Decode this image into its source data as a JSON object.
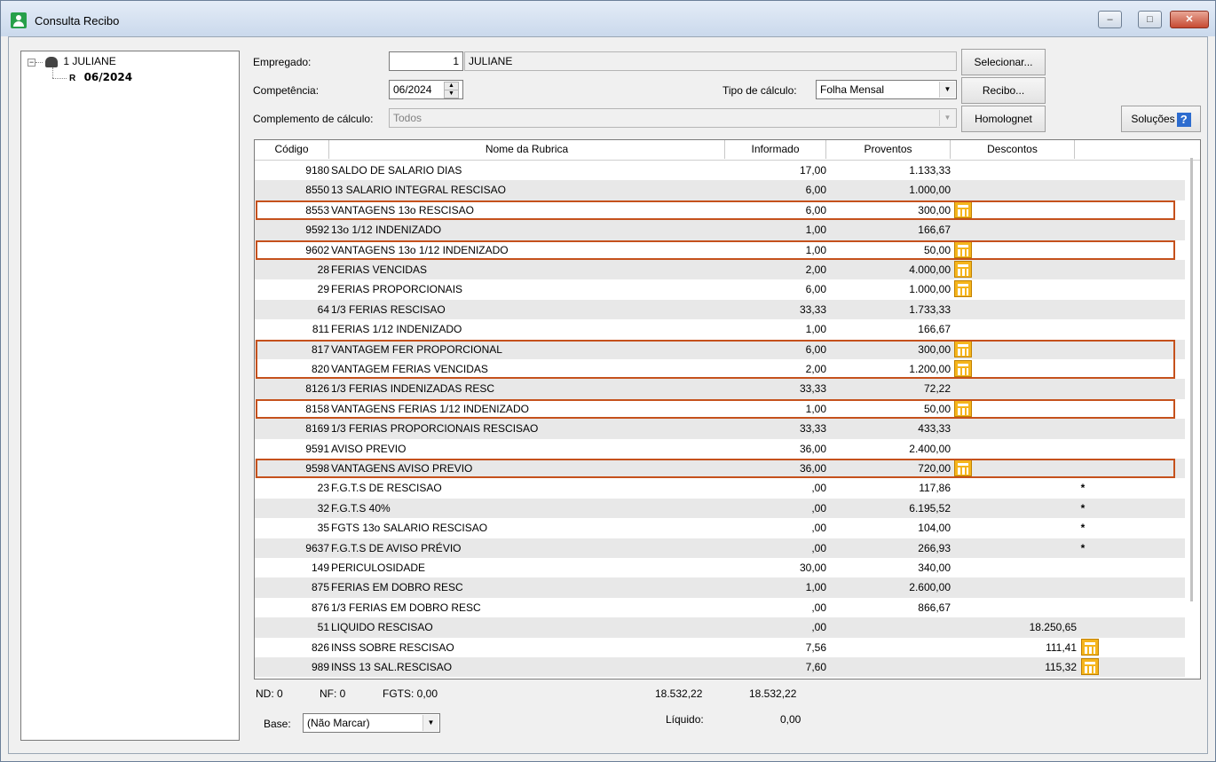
{
  "window": {
    "title": "Consulta Recibo",
    "minimize": "–",
    "maximize": "□",
    "close": "✕"
  },
  "tree": {
    "root_label": "1 JULIANE",
    "child_label": "06/2024",
    "child_marker": "R",
    "expander": "−"
  },
  "form": {
    "empregado_label": "Empregado:",
    "empregado_code": "1",
    "empregado_name": "JULIANE",
    "competencia_label": "Competência:",
    "competencia_value": "06/2024",
    "tipo_calculo_label": "Tipo de cálculo:",
    "tipo_calculo_value": "Folha Mensal",
    "complemento_label": "Complemento de cálculo:",
    "complemento_value": "Todos"
  },
  "buttons": {
    "selecionar": "Selecionar...",
    "recibo": "Recibo...",
    "homolognet": "Homolognet",
    "solucoes": "Soluções",
    "help": "?"
  },
  "grid": {
    "headers": {
      "codigo": "Código",
      "nome": "Nome da Rubrica",
      "informado": "Informado",
      "proventos": "Proventos",
      "descontos": "Descontos"
    },
    "rows": [
      {
        "code": "9180",
        "name": "SALDO DE SALARIO DIAS",
        "informado": "17,00",
        "proventos": "1.133,33",
        "descontos": "",
        "star": "",
        "calc": "",
        "highlight": false
      },
      {
        "code": "8550",
        "name": "13 SALARIO INTEGRAL RESCISAO",
        "informado": "6,00",
        "proventos": "1.000,00",
        "descontos": "",
        "star": "",
        "calc": "",
        "highlight": false
      },
      {
        "code": "8553",
        "name": "VANTAGENS 13o RESCISAO",
        "informado": "6,00",
        "proventos": "300,00",
        "descontos": "",
        "star": "",
        "calc": "prov",
        "highlight": true
      },
      {
        "code": "9592",
        "name": "13o 1/12 INDENIZADO",
        "informado": "1,00",
        "proventos": "166,67",
        "descontos": "",
        "star": "",
        "calc": "",
        "highlight": false
      },
      {
        "code": "9602",
        "name": "VANTAGENS 13o 1/12 INDENIZADO",
        "informado": "1,00",
        "proventos": "50,00",
        "descontos": "",
        "star": "",
        "calc": "prov",
        "highlight": true
      },
      {
        "code": "28",
        "name": "FERIAS VENCIDAS",
        "informado": "2,00",
        "proventos": "4.000,00",
        "descontos": "",
        "star": "",
        "calc": "prov",
        "highlight": false
      },
      {
        "code": "29",
        "name": "FERIAS PROPORCIONAIS",
        "informado": "6,00",
        "proventos": "1.000,00",
        "descontos": "",
        "star": "",
        "calc": "prov",
        "highlight": false
      },
      {
        "code": "64",
        "name": "1/3 FERIAS RESCISAO",
        "informado": "33,33",
        "proventos": "1.733,33",
        "descontos": "",
        "star": "",
        "calc": "",
        "highlight": false
      },
      {
        "code": "811",
        "name": "FERIAS 1/12 INDENIZADO",
        "informado": "1,00",
        "proventos": "166,67",
        "descontos": "",
        "star": "",
        "calc": "",
        "highlight": false
      },
      {
        "code": "817",
        "name": "VANTAGEM FER PROPORCIONAL",
        "informado": "6,00",
        "proventos": "300,00",
        "descontos": "",
        "star": "",
        "calc": "prov",
        "highlight": "top"
      },
      {
        "code": "820",
        "name": "VANTAGEM FERIAS VENCIDAS",
        "informado": "2,00",
        "proventos": "1.200,00",
        "descontos": "",
        "star": "",
        "calc": "prov",
        "highlight": "bottom"
      },
      {
        "code": "8126",
        "name": "1/3 FERIAS INDENIZADAS RESC",
        "informado": "33,33",
        "proventos": "72,22",
        "descontos": "",
        "star": "",
        "calc": "",
        "highlight": false
      },
      {
        "code": "8158",
        "name": "VANTAGENS FERIAS 1/12 INDENIZADO",
        "informado": "1,00",
        "proventos": "50,00",
        "descontos": "",
        "star": "",
        "calc": "prov",
        "highlight": true
      },
      {
        "code": "8169",
        "name": "1/3 FERIAS PROPORCIONAIS RESCISAO",
        "informado": "33,33",
        "proventos": "433,33",
        "descontos": "",
        "star": "",
        "calc": "",
        "highlight": false
      },
      {
        "code": "9591",
        "name": "AVISO PREVIO",
        "informado": "36,00",
        "proventos": "2.400,00",
        "descontos": "",
        "star": "",
        "calc": "",
        "highlight": false
      },
      {
        "code": "9598",
        "name": "VANTAGENS AVISO PREVIO",
        "informado": "36,00",
        "proventos": "720,00",
        "descontos": "",
        "star": "",
        "calc": "prov",
        "highlight": true
      },
      {
        "code": "23",
        "name": "F.G.T.S DE RESCISAO",
        "informado": ",00",
        "proventos": "117,86",
        "descontos": "",
        "star": "*",
        "calc": "",
        "highlight": false
      },
      {
        "code": "32",
        "name": "F.G.T.S 40%",
        "informado": ",00",
        "proventos": "6.195,52",
        "descontos": "",
        "star": "*",
        "calc": "",
        "highlight": false
      },
      {
        "code": "35",
        "name": "FGTS 13o SALARIO RESCISAO",
        "informado": ",00",
        "proventos": "104,00",
        "descontos": "",
        "star": "*",
        "calc": "",
        "highlight": false
      },
      {
        "code": "9637",
        "name": "F.G.T.S DE AVISO PRÉVIO",
        "informado": ",00",
        "proventos": "266,93",
        "descontos": "",
        "star": "*",
        "calc": "",
        "highlight": false
      },
      {
        "code": "149",
        "name": "PERICULOSIDADE",
        "informado": "30,00",
        "proventos": "340,00",
        "descontos": "",
        "star": "",
        "calc": "",
        "highlight": false
      },
      {
        "code": "875",
        "name": "FERIAS EM DOBRO RESC",
        "informado": "1,00",
        "proventos": "2.600,00",
        "descontos": "",
        "star": "",
        "calc": "",
        "highlight": false
      },
      {
        "code": "876",
        "name": "1/3 FERIAS EM DOBRO RESC",
        "informado": ",00",
        "proventos": "866,67",
        "descontos": "",
        "star": "",
        "calc": "",
        "highlight": false
      },
      {
        "code": "51",
        "name": "LIQUIDO RESCISAO",
        "informado": ",00",
        "proventos": "",
        "descontos": "18.250,65",
        "star": "",
        "calc": "",
        "highlight": false
      },
      {
        "code": "826",
        "name": "INSS SOBRE RESCISAO",
        "informado": "7,56",
        "proventos": "",
        "descontos": "111,41",
        "star": "",
        "calc": "desc",
        "highlight": false
      },
      {
        "code": "989",
        "name": "INSS 13 SAL.RESCISAO",
        "informado": "7,60",
        "proventos": "",
        "descontos": "115,32",
        "star": "",
        "calc": "desc",
        "highlight": false
      }
    ]
  },
  "footer": {
    "nd": "ND: 0",
    "nf": "NF: 0",
    "fgts": "FGTS: 0,00",
    "total_proventos": "18.532,22",
    "total_descontos": "18.532,22",
    "liquido_label": "Líquido:",
    "liquido_value": "0,00",
    "base_label": "Base:",
    "base_value": "(Não Marcar)"
  },
  "colors": {
    "highlight": "#c5511c",
    "calc_icon": "#f5b51c",
    "alt_row": "#e8e8e8"
  }
}
